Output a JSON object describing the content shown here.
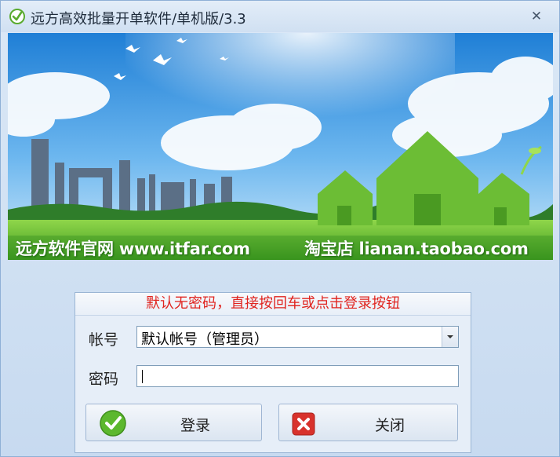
{
  "window": {
    "title": "远方高效批量开单软件/单机版/3.3",
    "close_symbol": "✕"
  },
  "banner": {
    "left_text": "远方软件官网 www.itfar.com",
    "right_text": "淘宝店 lianan.taobao.com"
  },
  "login": {
    "hint": "默认无密码，直接按回车或点击登录按钮",
    "account_label": "帐号",
    "account_value": "默认帐号（管理员）",
    "password_label": "密码",
    "password_value": "",
    "login_button": "登录",
    "close_button": "关闭"
  },
  "icons": {
    "app": "leaf-check-icon",
    "login": "green-check-icon",
    "close": "red-x-icon",
    "dropdown": "chevron-down-icon"
  },
  "colors": {
    "hint_text": "#e0241f",
    "login_icon": "#4fae2c",
    "close_icon": "#d8322c"
  }
}
